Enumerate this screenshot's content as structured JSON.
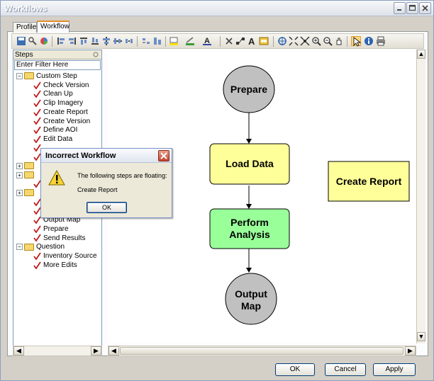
{
  "window": {
    "title": "Workflows"
  },
  "tabs": [
    {
      "label": "Profile"
    },
    {
      "label": "Workflow"
    }
  ],
  "steps_panel": {
    "header": "Steps",
    "filter_placeholder": "Enter Filter Here",
    "groups": [
      {
        "label": "Custom Step",
        "items": [
          "Check Version",
          "Clean Up",
          "Clip Imagery",
          "Create Report",
          "Create Version",
          "Define AOI",
          "Edit Data"
        ]
      },
      {
        "label": "Question",
        "items": [
          "Inventory Source",
          "More Edits"
        ]
      }
    ],
    "partial_items": [
      "Output Map",
      "Prepare",
      "Send Results"
    ]
  },
  "canvas": {
    "nodes": [
      {
        "label": "Prepare",
        "shape": "ellipse",
        "fill": "#c0c0c0"
      },
      {
        "label": "Load Data",
        "shape": "rect",
        "fill": "#ffff99"
      },
      {
        "label_line1": "Perform",
        "label_line2": "Analysis",
        "shape": "rect",
        "fill": "#99ff99"
      },
      {
        "label_line1": "Output",
        "label_line2": "Map",
        "shape": "ellipse",
        "fill": "#c0c0c0"
      },
      {
        "label": "Create Report",
        "shape": "rect",
        "fill": "#ffff99"
      }
    ]
  },
  "dialog": {
    "title": "Incorrect Workflow",
    "message": "The following steps are floating:",
    "detail": "Create Report",
    "ok_label": "OK"
  },
  "buttons": {
    "ok": "OK",
    "cancel": "Cancel",
    "apply": "Apply"
  },
  "colors": {
    "accent_tab": "#e68b2c",
    "title_bar": "#dfe3ea",
    "dialog_close": "#c2452f"
  }
}
